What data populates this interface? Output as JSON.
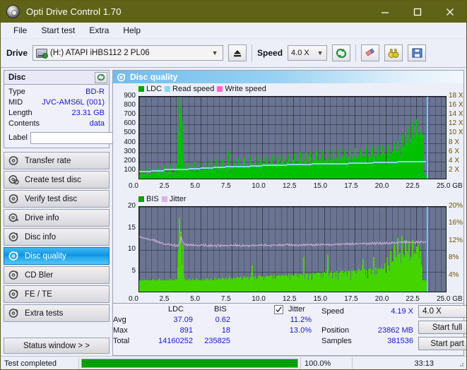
{
  "window": {
    "title": "Opti Drive Control 1.70",
    "icon": "disc-icon",
    "minimize": "minimize-icon",
    "maximize": "maximize-icon",
    "close": "close-icon"
  },
  "menu": {
    "items": [
      "File",
      "Start test",
      "Extra",
      "Help"
    ]
  },
  "toolbar": {
    "drive_label": "Drive",
    "drive_value": "(H:)  ATAPI iHBS112  2 PL06",
    "eject_icon": "eject-icon",
    "speed_label": "Speed",
    "speed_value": "4.0 X",
    "refresh_icon": "refresh-icon",
    "eraser_icon": "eraser-icon",
    "binoculars_icon": "binoculars-icon",
    "save_icon": "save-icon"
  },
  "disc": {
    "header": "Disc",
    "refresh_icon": "refresh-icon",
    "rows": [
      {
        "key": "Type",
        "value": "BD-R"
      },
      {
        "key": "MID",
        "value": "JVC-AMS6L (001)"
      },
      {
        "key": "Length",
        "value": "23.31 GB"
      },
      {
        "key": "Contents",
        "value": "data"
      }
    ],
    "label_key": "Label",
    "label_value": "",
    "label_placeholder": "",
    "disc_button_icon": "cd-icon"
  },
  "sidebar": {
    "items": [
      {
        "label": "Transfer rate",
        "icon": "disc-speed-icon",
        "active": false
      },
      {
        "label": "Create test disc",
        "icon": "disc-write-icon",
        "active": false
      },
      {
        "label": "Verify test disc",
        "icon": "disc-verify-icon",
        "active": false
      },
      {
        "label": "Drive info",
        "icon": "drive-info-icon",
        "active": false
      },
      {
        "label": "Disc info",
        "icon": "disc-info-icon",
        "active": false
      },
      {
        "label": "Disc quality",
        "icon": "disc-quality-icon",
        "active": true
      },
      {
        "label": "CD Bler",
        "icon": "disc-bler-icon",
        "active": false
      },
      {
        "label": "FE / TE",
        "icon": "disc-fete-icon",
        "active": false
      },
      {
        "label": "Extra tests",
        "icon": "disc-extra-icon",
        "active": false
      }
    ],
    "status_window": "Status window > >"
  },
  "panel": {
    "title": "Disc quality",
    "icon": "disc-quality-icon"
  },
  "results": {
    "col_ldc": "LDC",
    "col_bis": "BIS",
    "row_avg": "Avg",
    "row_max": "Max",
    "row_total": "Total",
    "ldc_avg": "37.09",
    "ldc_max": "891",
    "ldc_total": "14160252",
    "bis_avg": "0.62",
    "bis_max": "18",
    "bis_total": "235825",
    "jitter_label": "Jitter",
    "jitter_checked": true,
    "jitter_avg": "11.2%",
    "jitter_max": "13.0%",
    "speed_label": "Speed",
    "speed_value": "4.19 X",
    "position_label": "Position",
    "position_value": "23862 MB",
    "samples_label": "Samples",
    "samples_value": "381536",
    "speed_select": "4.0 X",
    "start_full": "Start full",
    "start_part": "Start part"
  },
  "statusbar": {
    "message": "Test completed",
    "progress_percent": "100.0%",
    "progress_value": 100,
    "elapsed": "33:13"
  },
  "colors": {
    "titlebar": "#5f6318",
    "accent_blue": "#1618c9",
    "ldc_green": "#00c000",
    "read_speed": "#87d7f5",
    "write_speed": "#ff66d4",
    "jitter_pink": "#d9b4dd",
    "bis_green": "#44d400",
    "plot_bg": "#6a7490",
    "progress_green": "#00a000"
  },
  "chart_data": [
    {
      "type": "bar",
      "id": "ldc-chart",
      "title": "",
      "xlabel": "GB",
      "ylabel": "",
      "xlim": [
        0,
        25
      ],
      "ylim": [
        0,
        900
      ],
      "y2lim": [
        0,
        18
      ],
      "y2label": "X",
      "grid": true,
      "legend": [
        {
          "label": "LDC",
          "color": "#00a000"
        },
        {
          "label": "Read speed",
          "color": "#87d7f5"
        },
        {
          "label": "Write speed",
          "color": "#ff66d4"
        }
      ],
      "xticks": [
        "0.0",
        "2.5",
        "5.0",
        "7.5",
        "10.0",
        "12.5",
        "15.0",
        "17.5",
        "20.0",
        "22.5",
        "25.0 GB"
      ],
      "yticks": [
        "100",
        "200",
        "300",
        "400",
        "500",
        "600",
        "700",
        "800",
        "900"
      ],
      "y2ticks": [
        "2 X",
        "4 X",
        "6 X",
        "8 X",
        "10 X",
        "12 X",
        "14 X",
        "16 X",
        "18 X"
      ],
      "data_end_gb": 23.31,
      "series": [
        {
          "name": "LDC",
          "color": "#00c000",
          "kind": "bars",
          "x": [
            0.05,
            0.2,
            0.35,
            0.5,
            0.65,
            0.8,
            0.95,
            1.1,
            1.25,
            1.4,
            1.55,
            1.7,
            1.85,
            2.0,
            2.15,
            2.3,
            2.45,
            2.6,
            2.75,
            2.9,
            3.05,
            3.2,
            3.35,
            3.45,
            3.5,
            3.55,
            3.7,
            3.85,
            4.0,
            4.15,
            4.3,
            4.45,
            4.6,
            4.75,
            4.9,
            5.05,
            5.2,
            5.35,
            5.5,
            5.65,
            5.8,
            5.95,
            6.1,
            6.25,
            6.4,
            6.55,
            6.7,
            6.85,
            7.0,
            7.15,
            7.3,
            7.45,
            7.6,
            7.75,
            7.9,
            8.05,
            8.2,
            8.35,
            8.5,
            8.65,
            8.8,
            8.95,
            9.1,
            9.25,
            9.4,
            9.55,
            9.7,
            9.85,
            10.0,
            10.15,
            10.3,
            10.45,
            10.6,
            10.75,
            10.9,
            11.05,
            11.2,
            11.35,
            11.5,
            11.65,
            11.8,
            11.95,
            12.1,
            12.25,
            12.4,
            12.55,
            12.7,
            12.85,
            13.0,
            13.15,
            13.3,
            13.45,
            13.6,
            13.75,
            13.9,
            14.05,
            14.2,
            14.35,
            14.5,
            14.65,
            14.8,
            14.95,
            15.1,
            15.25,
            15.4,
            15.55,
            15.7,
            15.85,
            16.0,
            16.15,
            16.3,
            16.45,
            16.6,
            16.75,
            16.9,
            17.05,
            17.2,
            17.35,
            17.5,
            17.65,
            17.8,
            17.95,
            18.1,
            18.25,
            18.4,
            18.55,
            18.7,
            18.85,
            19.0,
            19.15,
            19.3,
            19.45,
            19.6,
            19.75,
            19.9,
            20.05,
            20.2,
            20.35,
            20.5,
            20.65,
            20.8,
            20.95,
            21.1,
            21.25,
            21.4,
            21.55,
            21.7,
            21.85,
            22.0,
            22.15,
            22.3,
            22.45,
            22.6,
            22.75,
            22.9,
            23.05,
            23.2
          ],
          "values": [
            30,
            95,
            40,
            55,
            120,
            45,
            60,
            110,
            50,
            70,
            135,
            55,
            65,
            145,
            60,
            75,
            150,
            65,
            80,
            160,
            70,
            890,
            760,
            300,
            620,
            180,
            90,
            100,
            175,
            85,
            95,
            185,
            80,
            105,
            165,
            90,
            110,
            190,
            95,
            115,
            200,
            100,
            120,
            210,
            105,
            125,
            195,
            110,
            130,
            300,
            115,
            135,
            215,
            120,
            140,
            225,
            125,
            145,
            230,
            130,
            150,
            240,
            135,
            155,
            245,
            140,
            160,
            235,
            145,
            165,
            250,
            150,
            170,
            260,
            155,
            175,
            255,
            160,
            180,
            265,
            165,
            185,
            270,
            170,
            190,
            275,
            175,
            195,
            280,
            180,
            200,
            285,
            185,
            205,
            290,
            190,
            210,
            295,
            195,
            215,
            300,
            200,
            220,
            305,
            205,
            225,
            310,
            210,
            230,
            315,
            215,
            235,
            320,
            220,
            240,
            325,
            225,
            245,
            330,
            230,
            250,
            335,
            235,
            255,
            340,
            240,
            260,
            345,
            245,
            265,
            350,
            250,
            270,
            355,
            255,
            275,
            360,
            265,
            290,
            380,
            300,
            420,
            340,
            480,
            360,
            520,
            400,
            560,
            430,
            600,
            450,
            640,
            470,
            520,
            490
          ]
        },
        {
          "name": "Read speed",
          "color": "#87d7f5",
          "kind": "step-line",
          "x": [
            0.0,
            1.0,
            2.0,
            3.0,
            4.0,
            5.0,
            6.0,
            7.0,
            8.0,
            9.0,
            10.0,
            11.0,
            12.0,
            13.0,
            14.0,
            15.0,
            16.0,
            17.0,
            18.0,
            19.0,
            20.0,
            21.0,
            22.0,
            23.3
          ],
          "values": [
            2.0,
            2.2,
            2.4,
            2.5,
            2.6,
            2.8,
            2.9,
            3.0,
            3.1,
            3.2,
            3.3,
            3.4,
            3.5,
            3.5,
            3.6,
            3.7,
            3.7,
            3.8,
            3.85,
            3.9,
            4.0,
            4.1,
            4.15,
            4.19
          ]
        }
      ]
    },
    {
      "type": "bar",
      "id": "bis-jitter-chart",
      "title": "",
      "xlabel": "GB",
      "ylabel": "",
      "xlim": [
        0,
        25
      ],
      "ylim": [
        0,
        20
      ],
      "y2lim": [
        0,
        20
      ],
      "y2label": "%",
      "grid": true,
      "legend": [
        {
          "label": "BIS",
          "color": "#00a000"
        },
        {
          "label": "Jitter",
          "color": "#d9b4dd"
        }
      ],
      "xticks": [
        "0.0",
        "2.5",
        "5.0",
        "7.5",
        "10.0",
        "12.5",
        "15.0",
        "17.5",
        "20.0",
        "22.5",
        "25.0 GB"
      ],
      "yticks": [
        "5",
        "10",
        "15",
        "20"
      ],
      "y2ticks": [
        "4%",
        "8%",
        "12%",
        "16%",
        "20%"
      ],
      "data_end_gb": 23.31,
      "series": [
        {
          "name": "BIS",
          "color": "#44d400",
          "kind": "bars",
          "x": [
            0.05,
            0.2,
            0.35,
            0.5,
            0.65,
            0.8,
            0.95,
            1.1,
            1.25,
            1.4,
            1.55,
            1.7,
            1.85,
            2.0,
            2.15,
            2.3,
            2.45,
            2.6,
            2.75,
            2.9,
            3.05,
            3.2,
            3.35,
            3.45,
            3.5,
            3.55,
            3.7,
            3.85,
            4.0,
            4.15,
            4.3,
            4.45,
            4.6,
            4.75,
            4.9,
            5.05,
            5.2,
            5.35,
            5.5,
            5.65,
            5.8,
            5.95,
            6.1,
            6.25,
            6.4,
            6.55,
            6.7,
            6.85,
            7.0,
            7.15,
            7.3,
            7.45,
            7.6,
            7.75,
            7.9,
            8.05,
            8.2,
            8.35,
            8.5,
            8.65,
            8.8,
            8.95,
            9.1,
            9.25,
            9.4,
            9.55,
            9.7,
            9.85,
            10.0,
            10.15,
            10.3,
            10.45,
            10.6,
            10.75,
            10.9,
            11.05,
            11.2,
            11.35,
            11.5,
            11.65,
            11.8,
            11.95,
            12.1,
            12.25,
            12.4,
            12.55,
            12.7,
            12.85,
            13.0,
            13.15,
            13.3,
            13.45,
            13.6,
            13.75,
            13.9,
            14.05,
            14.2,
            14.35,
            14.5,
            14.65,
            14.8,
            14.95,
            15.1,
            15.25,
            15.4,
            15.55,
            15.7,
            15.85,
            16.0,
            16.15,
            16.3,
            16.45,
            16.6,
            16.75,
            16.9,
            17.05,
            17.2,
            17.35,
            17.5,
            17.65,
            17.8,
            17.95,
            18.1,
            18.25,
            18.4,
            18.55,
            18.7,
            18.85,
            19.0,
            19.15,
            19.3,
            19.45,
            19.6,
            19.75,
            19.9,
            20.05,
            20.2,
            20.35,
            20.5,
            20.65,
            20.8,
            20.95,
            21.1,
            21.25,
            21.4,
            21.55,
            21.7,
            21.85,
            22.0,
            22.15,
            22.3,
            22.45,
            22.6,
            22.75,
            22.9,
            23.05,
            23.2
          ],
          "values": [
            2.4,
            2.6,
            2.2,
            2.8,
            2.3,
            2.7,
            2.5,
            2.9,
            2.4,
            2.6,
            3.0,
            2.5,
            2.7,
            2.4,
            2.8,
            2.6,
            3.0,
            2.5,
            2.7,
            2.9,
            2.6,
            17.0,
            14.0,
            6.0,
            11.0,
            4.0,
            2.8,
            2.6,
            3.0,
            2.7,
            2.9,
            2.5,
            3.1,
            2.8,
            2.6,
            3.0,
            2.7,
            2.9,
            3.1,
            2.8,
            3.0,
            2.7,
            3.2,
            2.9,
            3.1,
            2.8,
            3.3,
            3.0,
            3.2,
            2.9,
            3.4,
            3.1,
            3.3,
            3.0,
            3.5,
            3.2,
            3.4,
            3.1,
            3.6,
            3.3,
            3.5,
            3.2,
            6.0,
            3.4,
            3.6,
            3.3,
            3.7,
            3.4,
            3.6,
            3.5,
            3.8,
            3.5,
            3.7,
            3.6,
            3.9,
            3.6,
            3.8,
            3.7,
            4.0,
            3.7,
            3.9,
            3.8,
            4.1,
            3.8,
            4.0,
            3.9,
            4.2,
            3.9,
            4.1,
            4.0,
            8.0,
            4.1,
            4.3,
            4.0,
            4.2,
            4.4,
            4.1,
            4.3,
            4.5,
            4.2,
            4.4,
            4.6,
            4.3,
            8.5,
            4.5,
            4.7,
            4.4,
            4.6,
            4.8,
            4.5,
            4.7,
            4.9,
            4.6,
            4.8,
            5.0,
            4.7,
            4.9,
            5.1,
            4.8,
            5.0,
            5.2,
            4.9,
            7.5,
            5.3,
            5.0,
            5.2,
            5.4,
            5.1,
            8.0,
            5.5,
            5.2,
            5.4,
            5.6,
            5.3,
            6.5,
            8.0,
            6.0,
            9.5,
            7.0,
            11.0,
            8.0,
            12.5,
            9.0,
            13.0,
            8.5,
            12.0,
            9.5,
            11.5,
            8.0,
            12.0,
            9.0,
            10.5,
            11.0,
            9.5
          ]
        },
        {
          "name": "Jitter",
          "color": "#d9b4dd",
          "kind": "line",
          "x": [
            0.0,
            0.4,
            0.8,
            1.2,
            1.6,
            2.0,
            2.4,
            2.8,
            3.2,
            3.4,
            3.6,
            4.0,
            4.5,
            5.0,
            6.0,
            7.0,
            8.0,
            9.0,
            10.0,
            11.0,
            12.0,
            13.0,
            14.0,
            15.0,
            16.0,
            17.0,
            18.0,
            19.0,
            20.0,
            21.0,
            22.0,
            23.3
          ],
          "values": [
            13.0,
            12.7,
            12.5,
            12.3,
            11.8,
            11.4,
            11.3,
            11.2,
            10.8,
            13.0,
            11.3,
            11.1,
            11.1,
            11.1,
            11.0,
            11.0,
            11.1,
            11.0,
            11.1,
            11.1,
            11.2,
            11.1,
            11.2,
            11.2,
            11.3,
            11.4,
            11.5,
            11.5,
            11.6,
            11.7,
            11.8,
            11.8
          ]
        }
      ]
    }
  ]
}
